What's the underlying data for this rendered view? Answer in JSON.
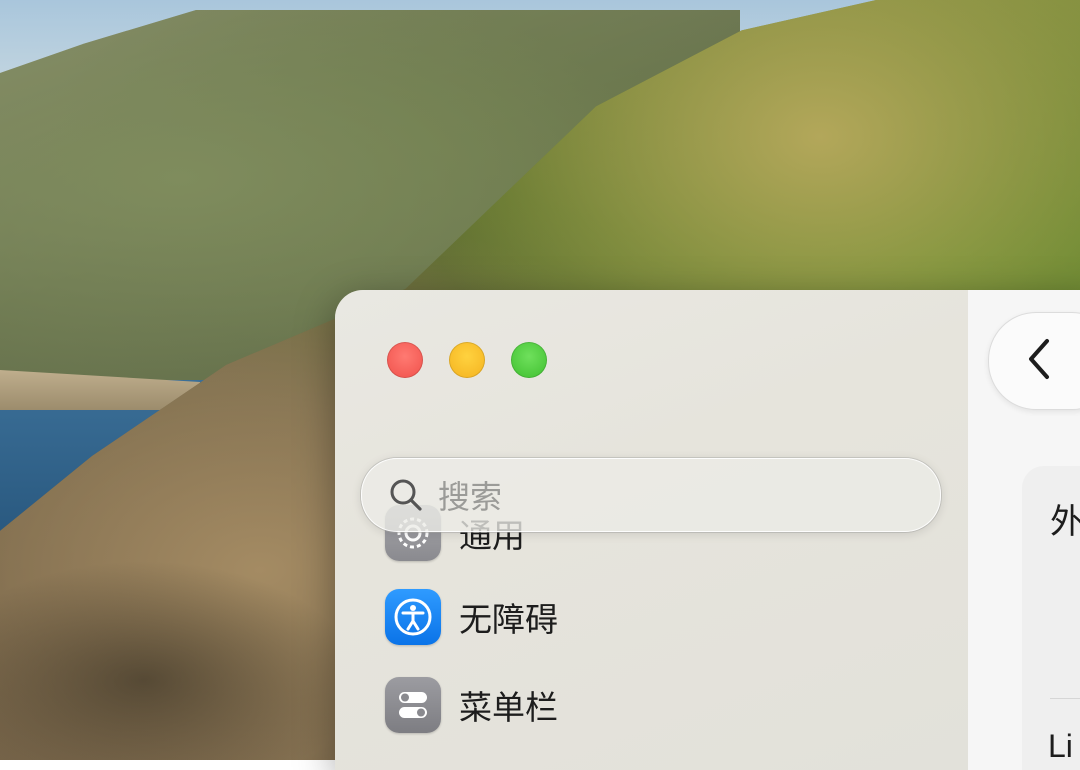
{
  "search": {
    "placeholder": "搜索"
  },
  "sidebar": {
    "items": [
      {
        "label": "通用",
        "icon": "gear-icon"
      },
      {
        "label": "无障碍",
        "icon": "accessibility-icon"
      },
      {
        "label": "菜单栏",
        "icon": "toggle-switches-icon"
      }
    ]
  },
  "content": {
    "back_icon": "chevron-left-icon",
    "section_label_partial": "外",
    "row_label_partial": "Li"
  },
  "colors": {
    "close": "#f0504a",
    "minimize": "#f4b21f",
    "zoom": "#3fbf2f",
    "accessibility_icon_bg": "#0a73e8"
  }
}
